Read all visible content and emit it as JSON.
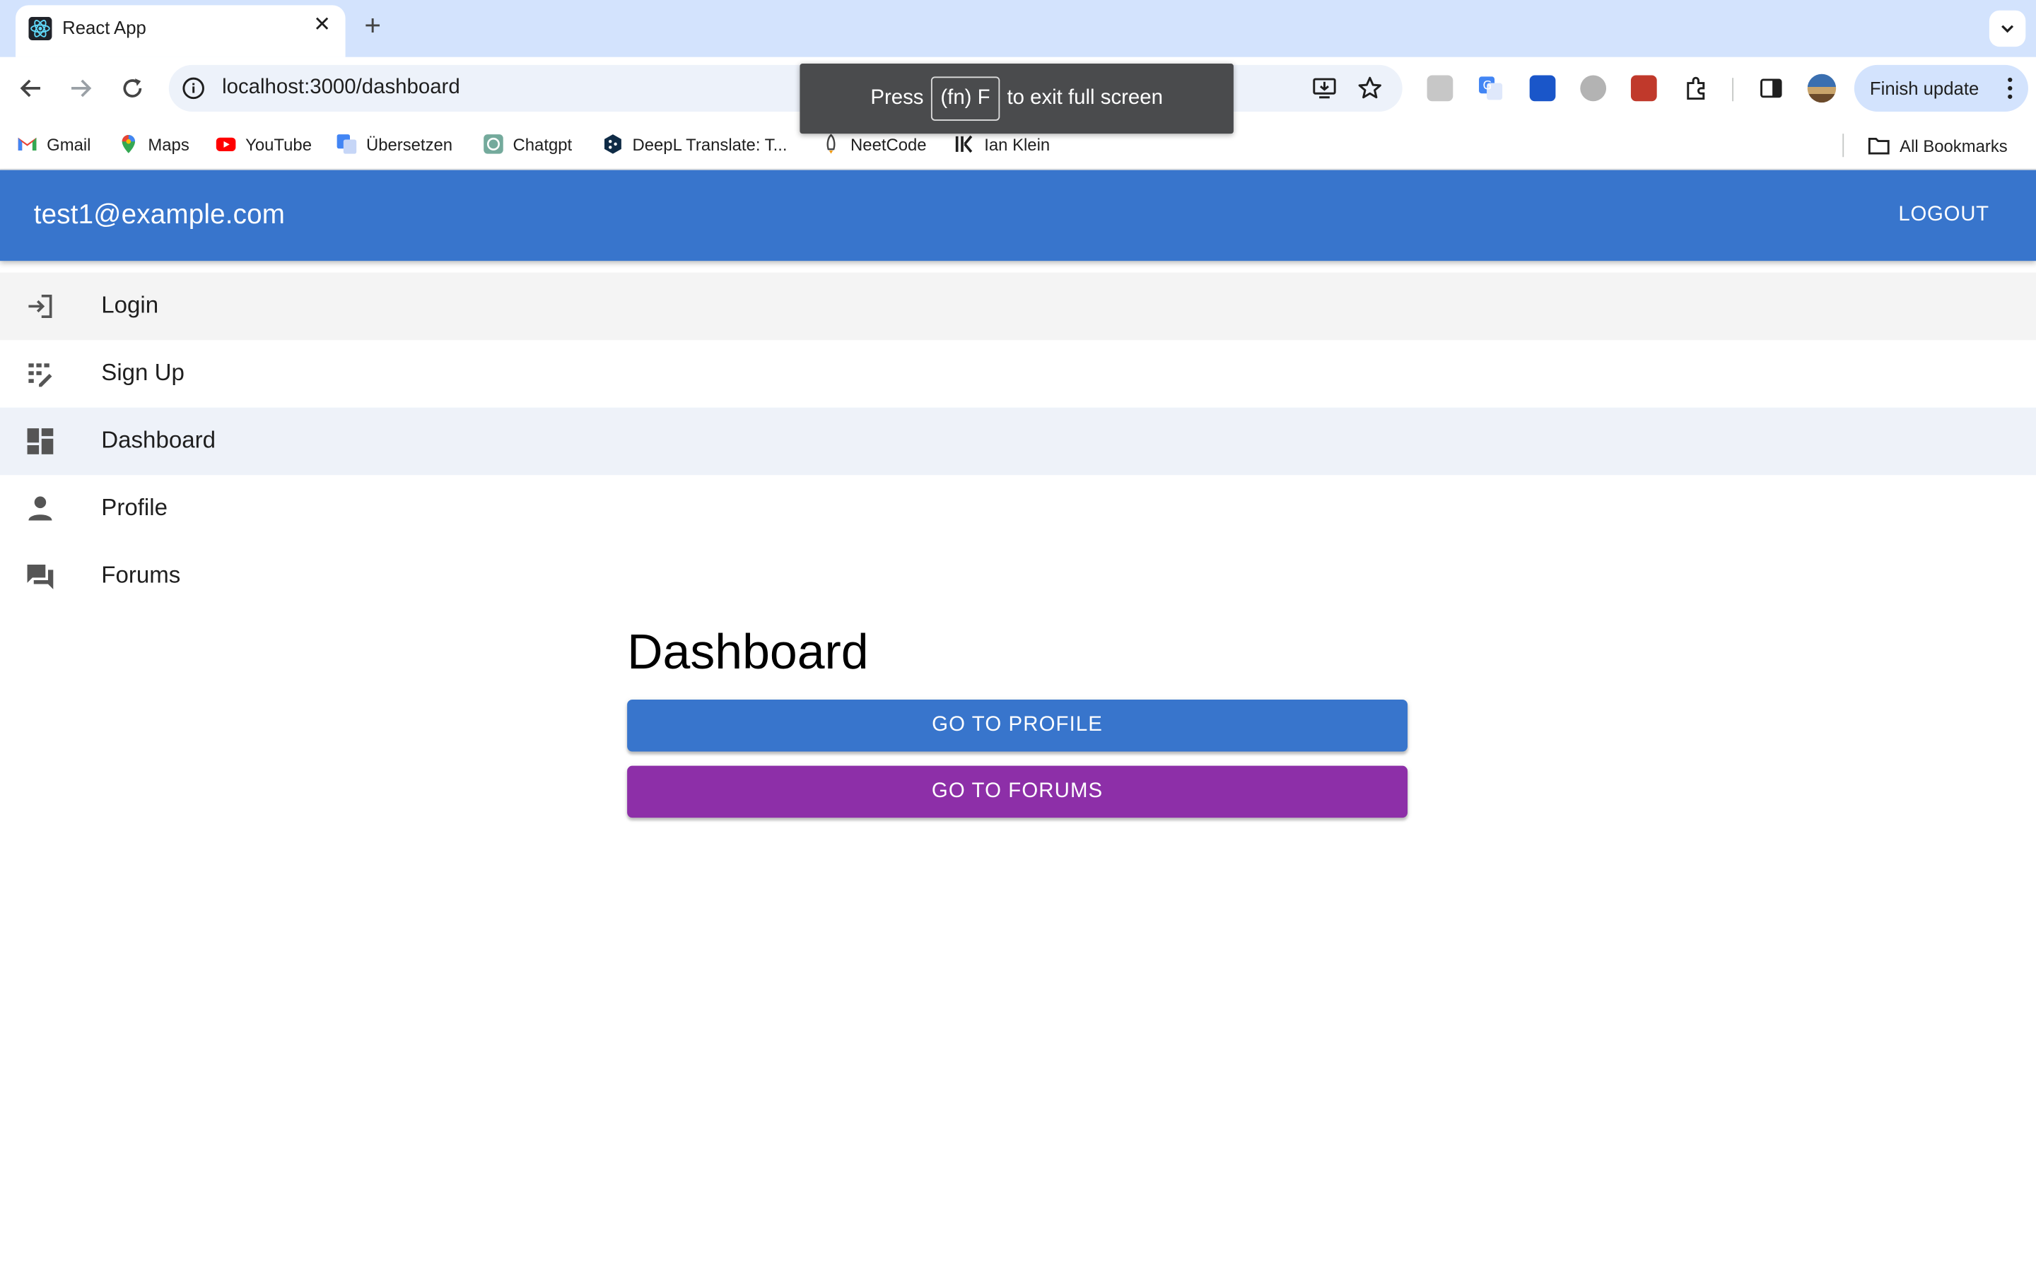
{
  "browser": {
    "tab": {
      "title": "React App"
    },
    "address": {
      "url": "localhost:3000/dashboard"
    },
    "finish_update_label": "Finish update",
    "fullscreen_toast": {
      "press": "Press",
      "key": "(fn) F",
      "rest": "to exit full screen"
    },
    "bookmarks": [
      {
        "label": "Gmail",
        "icon": "gmail-icon"
      },
      {
        "label": "Maps",
        "icon": "maps-icon"
      },
      {
        "label": "YouTube",
        "icon": "youtube-icon"
      },
      {
        "label": "Übersetzen",
        "icon": "translate-icon"
      },
      {
        "label": "Chatgpt",
        "icon": "chatgpt-icon"
      },
      {
        "label": "DeepL Translate: T...",
        "icon": "deepl-icon"
      },
      {
        "label": "NeetCode",
        "icon": "rocket-icon"
      },
      {
        "label": "Ian Klein",
        "icon": "ik-logo-icon"
      }
    ],
    "all_bookmarks": "All Bookmarks"
  },
  "app": {
    "user_email": "test1@example.com",
    "logout_label": "LOGOUT",
    "nav": [
      {
        "label": "Login",
        "icon": "login-icon"
      },
      {
        "label": "Sign Up",
        "icon": "signup-icon"
      },
      {
        "label": "Dashboard",
        "icon": "dashboard-icon"
      },
      {
        "label": "Profile",
        "icon": "person-icon"
      },
      {
        "label": "Forums",
        "icon": "forum-icon"
      }
    ],
    "page_title": "Dashboard",
    "buttons": {
      "profile": "GO TO PROFILE",
      "forums": "GO TO FORUMS"
    }
  },
  "colors": {
    "primary": "#3875cc",
    "secondary": "#8d2fa8",
    "tabstrip": "#d3e3fd"
  }
}
